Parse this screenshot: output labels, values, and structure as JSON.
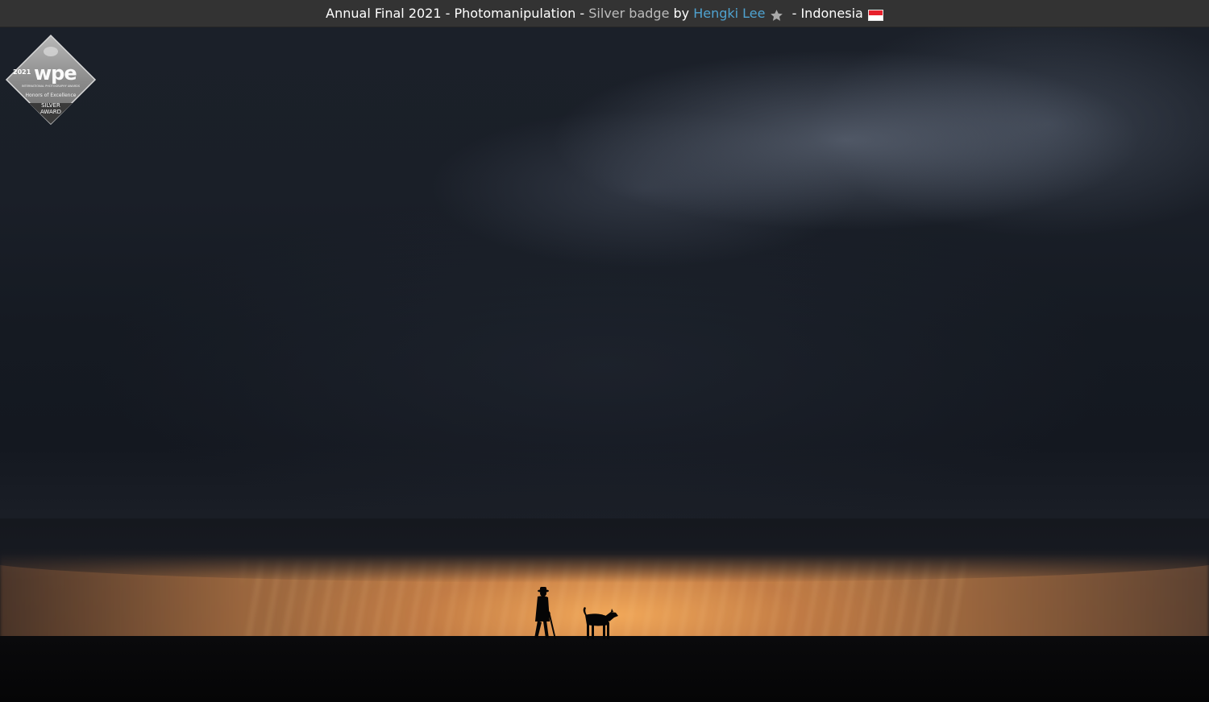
{
  "caption": {
    "contest": "Annual Final 2021",
    "separator1": " - ",
    "category": "Photomanipulation",
    "separator2": " - ",
    "badge": "Silver badge",
    "by": " by ",
    "author": "Hengki Lee",
    "separator3": " - ",
    "country": "Indonesia",
    "star_icon": "star-icon",
    "flag_icon": "indonesia-flag-icon",
    "link_color": "#4fa3d1"
  },
  "award_badge": {
    "year": "2021",
    "logo": "wpe",
    "small_text": "INTERNATIONAL PHOTOGRAPHY AWARDS",
    "honors": "Honors of Excellence",
    "line1": "SILVER",
    "line2": "AWARD"
  },
  "photo": {
    "subject_icons": [
      "person-silhouette",
      "dog-silhouette"
    ],
    "colors": {
      "sky": "#1a1f28",
      "glow": "#e1965a",
      "ground": "#07070a"
    }
  }
}
